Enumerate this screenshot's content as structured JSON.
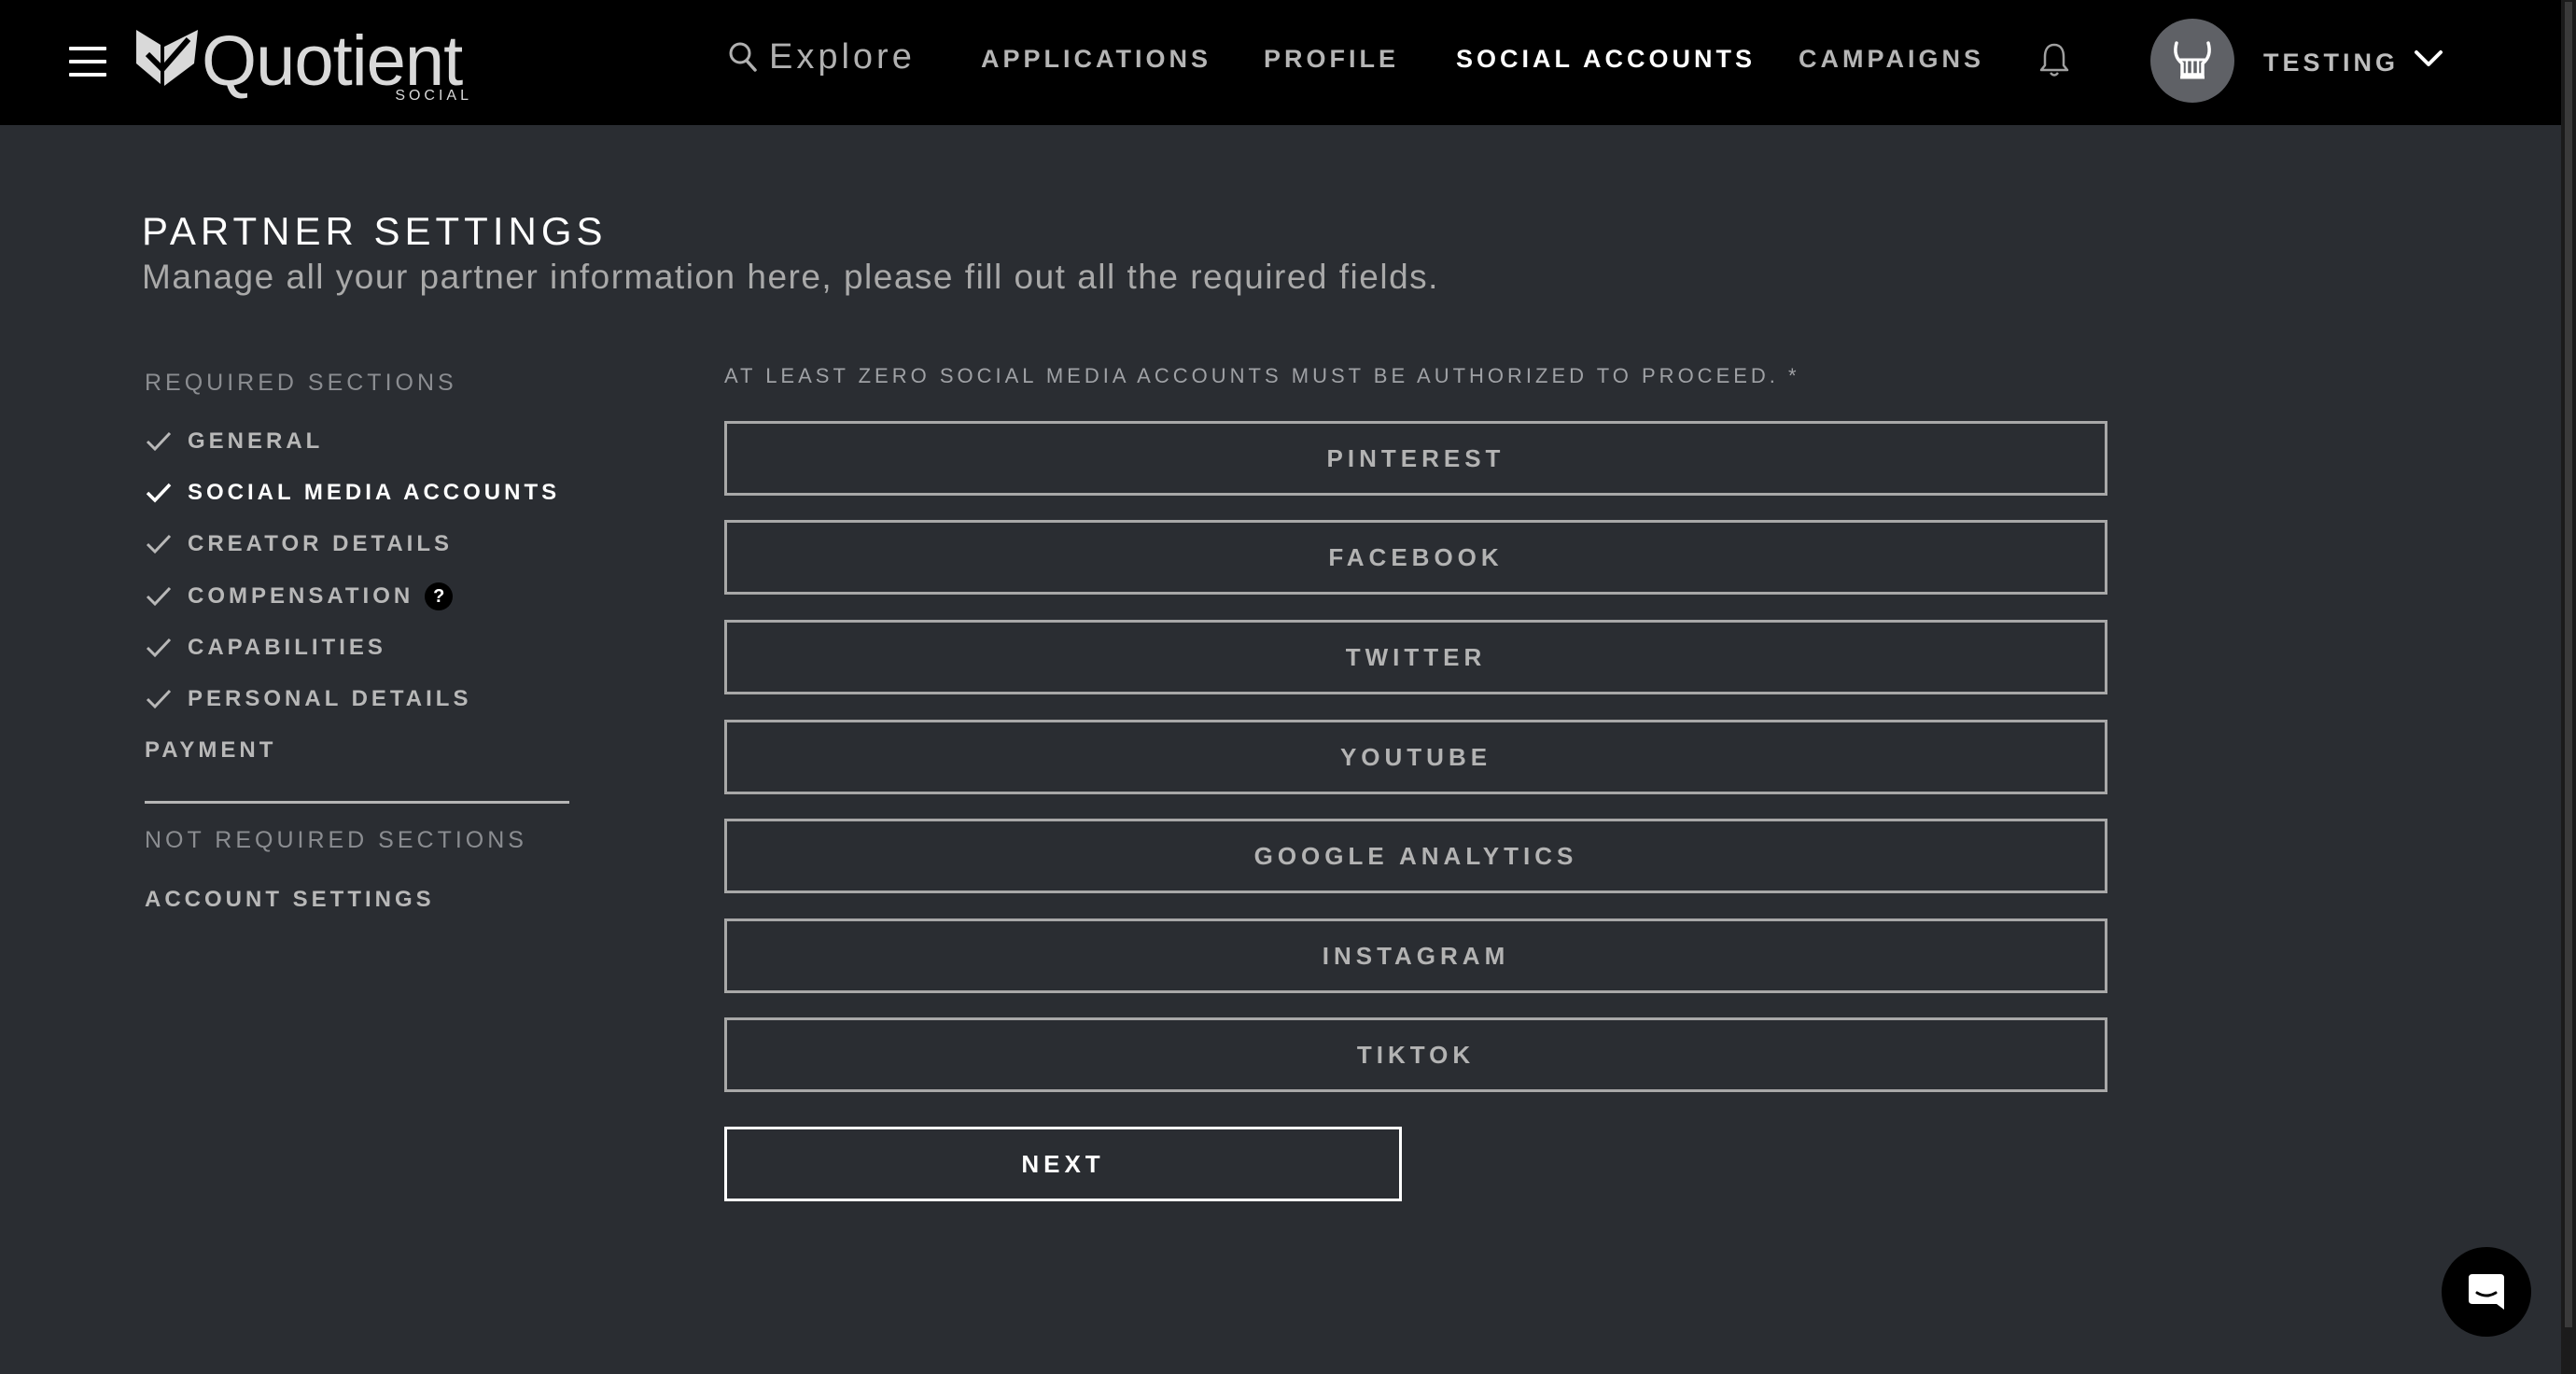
{
  "colors": {
    "topbar_bg": "#000000",
    "page_bg": "#2a2d32",
    "text_primary": "#ffffff",
    "text_muted": "#a9a9a9",
    "button_border": "#a8a8a8"
  },
  "topbar": {
    "menu_icon": "hamburger-icon",
    "logo": {
      "wordmark": "Quotient",
      "subtitle": "SOCIAL",
      "icon": "shield-check-logo"
    },
    "explore": {
      "icon": "search-icon",
      "label": "Explore"
    },
    "nav": [
      {
        "label": "APPLICATIONS",
        "active": false
      },
      {
        "label": "PROFILE",
        "active": false
      },
      {
        "label": "SOCIAL ACCOUNTS",
        "active": true
      },
      {
        "label": "CAMPAIGNS",
        "active": false
      }
    ],
    "bell_icon": "bell-icon",
    "avatar_icon": "lyre-icon",
    "user_name": "TESTING",
    "user_menu_icon": "chevron-down-icon"
  },
  "header": {
    "title": "PARTNER SETTINGS",
    "subtitle": "Manage all your partner information here, please fill out all the required fields."
  },
  "sidebar": {
    "required_label": "REQUIRED SECTIONS",
    "required_items": [
      {
        "label": "GENERAL",
        "checked": true,
        "active": false
      },
      {
        "label": "SOCIAL MEDIA ACCOUNTS",
        "checked": true,
        "active": true
      },
      {
        "label": "CREATOR DETAILS",
        "checked": true,
        "active": false
      },
      {
        "label": "COMPENSATION",
        "checked": true,
        "active": false,
        "help": "?"
      },
      {
        "label": "CAPABILITIES",
        "checked": true,
        "active": false
      },
      {
        "label": "PERSONAL DETAILS",
        "checked": true,
        "active": false
      },
      {
        "label": "PAYMENT",
        "checked": false,
        "active": false
      }
    ],
    "not_required_label": "NOT REQUIRED SECTIONS",
    "not_required_items": [
      {
        "label": "ACCOUNT SETTINGS"
      }
    ]
  },
  "main": {
    "notice": "AT LEAST ZERO SOCIAL MEDIA ACCOUNTS MUST BE AUTHORIZED TO PROCEED. *",
    "social_buttons": [
      {
        "label": "PINTEREST"
      },
      {
        "label": "FACEBOOK"
      },
      {
        "label": "TWITTER"
      },
      {
        "label": "YOUTUBE"
      },
      {
        "label": "GOOGLE ANALYTICS"
      },
      {
        "label": "INSTAGRAM"
      },
      {
        "label": "TIKTOK"
      }
    ],
    "next_label": "NEXT"
  },
  "chat": {
    "icon": "chat-bubble-icon"
  }
}
